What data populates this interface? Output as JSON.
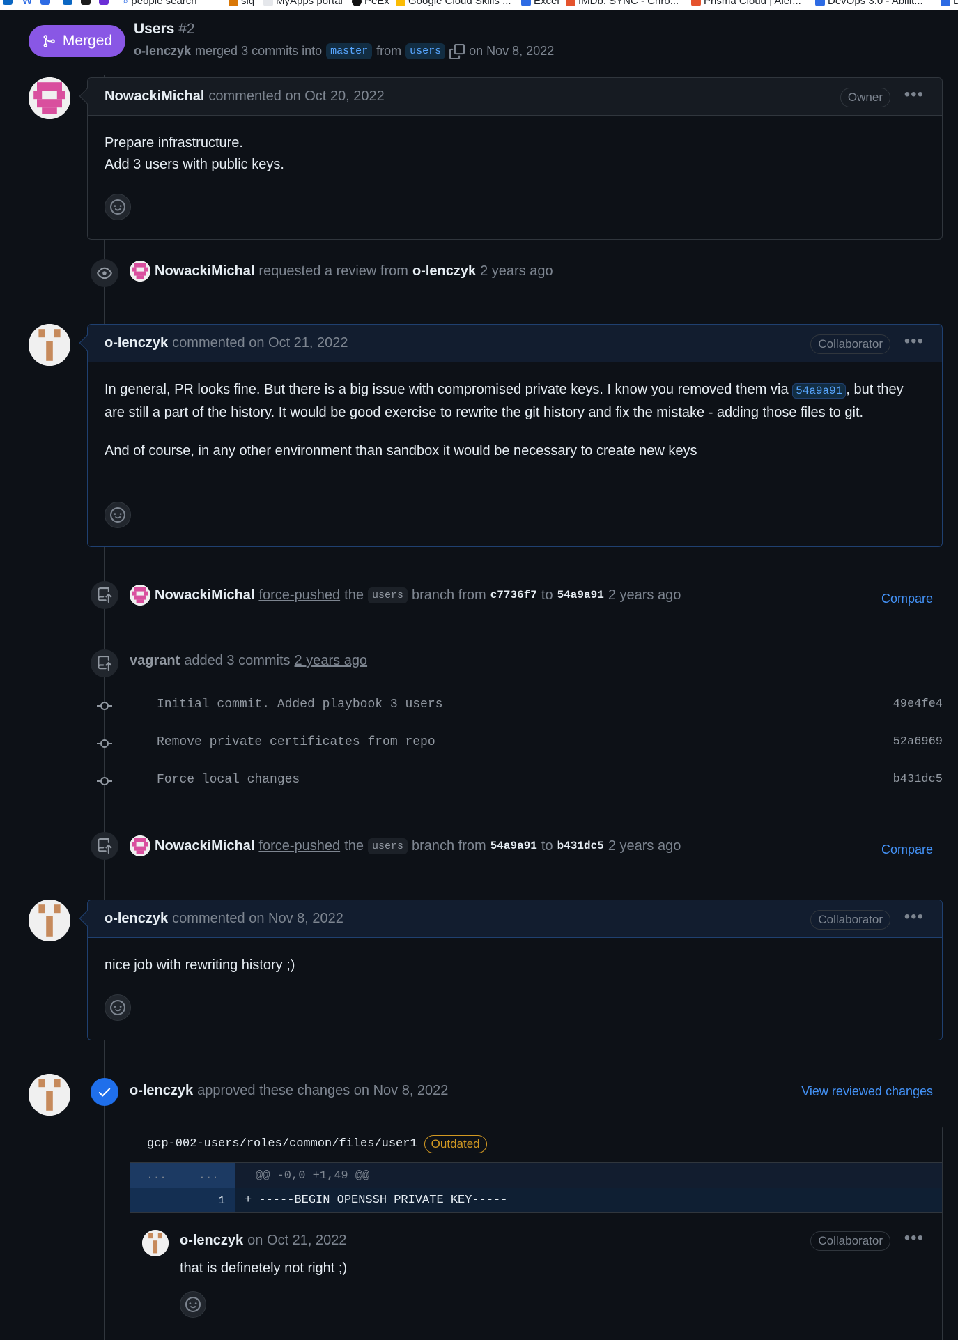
{
  "bookmarks": [
    {
      "label": "",
      "color": "#0a66c2"
    },
    {
      "label": "W",
      "color": "#ffffff"
    },
    {
      "label": "",
      "color": "#2d6be4"
    },
    {
      "label": "",
      "color": "#0a66c2"
    },
    {
      "label": "",
      "color": "#1b1b1b"
    },
    {
      "label": "",
      "color": "#6b2fd6"
    },
    {
      "label": "",
      "color": "#ffffff"
    },
    {
      "label": "people search",
      "color": "#ffffff"
    },
    {
      "label": "siq",
      "color": "#d97706"
    },
    {
      "label": "MyApps portal",
      "color": "#ffffff"
    },
    {
      "label": "PeEx",
      "color": "#111111"
    },
    {
      "label": "Google Cloud Skills ...",
      "color": "#fbbc04"
    },
    {
      "label": "Excel",
      "color": "#2d6be4"
    },
    {
      "label": "IMDb: SYNC - Chro...",
      "color": "#e5532d"
    },
    {
      "label": "Prisma Cloud | Aler...",
      "color": "#e5532d"
    },
    {
      "label": "DevOps 3.0 - Abilit...",
      "color": "#2d6be4"
    },
    {
      "label": "D",
      "color": "#2d6be4"
    }
  ],
  "header": {
    "status": "Merged",
    "title": "Users",
    "number": "#2",
    "merger": "o-lenczyk",
    "merged_text": "merged 3 commits into",
    "base_branch": "master",
    "from_text": "from",
    "head_branch": "users",
    "date_text": "on Nov 8, 2022"
  },
  "comments": [
    {
      "author": "NowackiMichal",
      "meta": "commented on Oct 20, 2022",
      "role": "Owner",
      "lines": [
        "Prepare infrastructure.",
        "Add 3 users with public keys."
      ]
    },
    {
      "author": "o-lenczyk",
      "meta": "commented on Oct 21, 2022",
      "role": "Collaborator",
      "p1_before": "In general, PR looks fine. But there is a big issue with compromised private keys. I know you removed them via",
      "p1_sha": "54a9a91",
      "p1_after": ", but they are still a part of the history. It would be good exercise to rewrite the git history and fix the mistake - adding those files to git.",
      "p2": "And of course, in any other environment than sandbox it would be necessary to create new keys"
    },
    {
      "author": "o-lenczyk",
      "meta": "commented on Nov 8, 2022",
      "role": "Collaborator",
      "body": "nice job with rewriting history ;)"
    }
  ],
  "events": {
    "review_request": {
      "actor": "NowackiMichal",
      "text": "requested a review from",
      "target": "o-lenczyk",
      "time": "2 years ago"
    },
    "force_push_1": {
      "actor": "NowackiMichal",
      "action": "force-pushed",
      "the": "the",
      "branch": "users",
      "branch_from": "branch from",
      "from_sha": "c7736f7",
      "to": "to",
      "to_sha": "54a9a91",
      "time": "2 years ago",
      "compare": "Compare"
    },
    "commits_added": {
      "actor": "vagrant",
      "text": "added 3 commits",
      "time": "2 years ago",
      "commits": [
        {
          "message": "Initial commit. Added playbook 3 users",
          "sha": "49e4fe4"
        },
        {
          "message": "Remove private certificates from repo",
          "sha": "52a6969"
        },
        {
          "message": "Force local changes",
          "sha": "b431dc5"
        }
      ]
    },
    "force_push_2": {
      "actor": "NowackiMichal",
      "action": "force-pushed",
      "the": "the",
      "branch": "users",
      "branch_from": "branch from",
      "from_sha": "54a9a91",
      "to": "to",
      "to_sha": "b431dc5",
      "time": "2 years ago",
      "compare": "Compare"
    }
  },
  "review": {
    "actor": "o-lenczyk",
    "text": "approved these changes on Nov 8, 2022",
    "view_link": "View reviewed changes",
    "file_path": "gcp-002-users/roles/common/files/user1",
    "outdated": "Outdated",
    "hunk_left": "...",
    "hunk_right": "...",
    "hunk": "@@ -0,0 +1,49 @@",
    "line_no": "1",
    "line": "+ -----BEGIN OPENSSH PRIVATE KEY-----",
    "inline_comment": {
      "author": "o-lenczyk",
      "meta": "on Oct 21, 2022",
      "role": "Collaborator",
      "body": "that is definetely not right ;)"
    }
  },
  "colors": {
    "background": "#0d1117",
    "merged": "#8957e5",
    "link": "#4493f8",
    "approved": "#1f6feb",
    "outdated": "#d29922"
  }
}
